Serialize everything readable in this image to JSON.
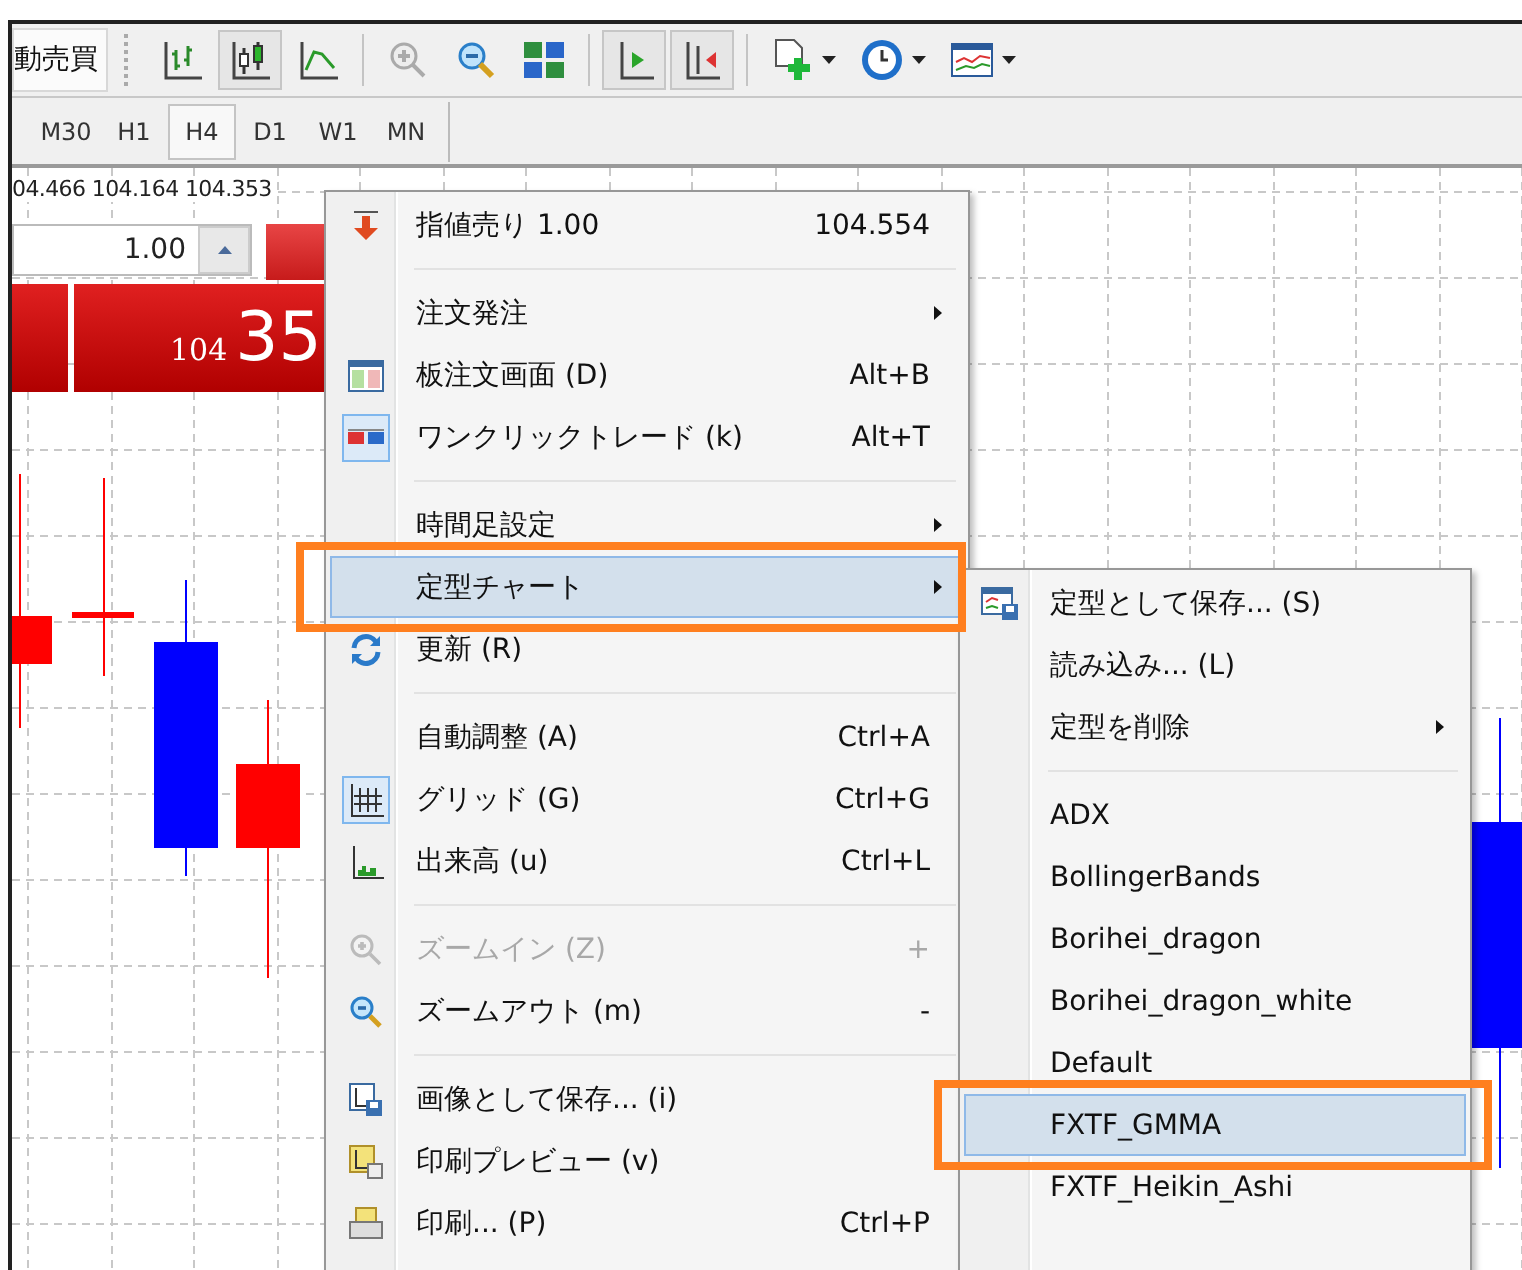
{
  "toolbar": {
    "partial_label": "動売買",
    "buttons": [
      {
        "kind": "bar-chart",
        "pressed": false,
        "dropdown": false
      },
      {
        "kind": "candle-chart",
        "pressed": true,
        "dropdown": false
      },
      {
        "kind": "line-chart",
        "pressed": false,
        "dropdown": false
      },
      {
        "kind": "zoom-in",
        "pressed": false,
        "dropdown": false
      },
      {
        "kind": "zoom-out",
        "pressed": false,
        "dropdown": false
      },
      {
        "kind": "tile",
        "pressed": false,
        "dropdown": false
      },
      {
        "kind": "auto-scroll",
        "pressed": true,
        "dropdown": false
      },
      {
        "kind": "chart-shift",
        "pressed": true,
        "dropdown": false
      },
      {
        "kind": "new-chart",
        "pressed": false,
        "dropdown": true
      },
      {
        "kind": "clock",
        "pressed": false,
        "dropdown": true
      },
      {
        "kind": "indicator",
        "pressed": false,
        "dropdown": true
      }
    ]
  },
  "timeframes": [
    {
      "label": "M30",
      "selected": false
    },
    {
      "label": "H1",
      "selected": false
    },
    {
      "label": "H4",
      "selected": true
    },
    {
      "label": "D1",
      "selected": false
    },
    {
      "label": "W1",
      "selected": false
    },
    {
      "label": "MN",
      "selected": false
    }
  ],
  "quote": {
    "prices": "04.466 104.164 104.353",
    "lots": "1.00",
    "price_small": "104",
    "price_big": "35"
  },
  "menu": {
    "items": [
      {
        "kind": "item",
        "label": "指値売り 1.00",
        "shortcut": "104.554",
        "checked": false,
        "disabled": false,
        "selected": false
      },
      {
        "kind": "separator"
      },
      {
        "kind": "item",
        "label": "注文発注",
        "submenu": true,
        "checked": false,
        "disabled": false,
        "selected": false
      },
      {
        "kind": "item",
        "label": "板注文画面 (D)",
        "shortcut": "Alt+B",
        "checked": false,
        "disabled": false,
        "selected": false
      },
      {
        "kind": "item",
        "label": "ワンクリックトレード (k)",
        "shortcut": "Alt+T",
        "checked": true,
        "disabled": false,
        "selected": false
      },
      {
        "kind": "separator"
      },
      {
        "kind": "item",
        "label": "時間足設定",
        "submenu": true,
        "checked": false,
        "disabled": false,
        "selected": false
      },
      {
        "kind": "item",
        "label": "定型チャート",
        "submenu": true,
        "checked": false,
        "disabled": false,
        "selected": true,
        "annotated": true
      },
      {
        "kind": "item",
        "label": "更新 (R)",
        "checked": false,
        "disabled": false,
        "selected": false
      },
      {
        "kind": "separator"
      },
      {
        "kind": "item",
        "label": "自動調整 (A)",
        "shortcut": "Ctrl+A",
        "checked": false,
        "disabled": false,
        "selected": false
      },
      {
        "kind": "item",
        "label": "グリッド (G)",
        "shortcut": "Ctrl+G",
        "checked": true,
        "disabled": false,
        "selected": false
      },
      {
        "kind": "item",
        "label": "出来高 (u)",
        "shortcut": "Ctrl+L",
        "checked": false,
        "disabled": false,
        "selected": false
      },
      {
        "kind": "separator"
      },
      {
        "kind": "item",
        "label": "ズームイン (Z)",
        "shortcut": "+",
        "checked": false,
        "disabled": true,
        "selected": false
      },
      {
        "kind": "item",
        "label": "ズームアウト (m)",
        "shortcut": "-",
        "checked": false,
        "disabled": false,
        "selected": false
      },
      {
        "kind": "separator"
      },
      {
        "kind": "item",
        "label": "画像として保存... (i)",
        "checked": false,
        "disabled": false,
        "selected": false
      },
      {
        "kind": "item",
        "label": "印刷プレビュー (v)",
        "checked": false,
        "disabled": false,
        "selected": false
      },
      {
        "kind": "item",
        "label": "印刷... (P)",
        "shortcut": "Ctrl+P",
        "checked": false,
        "disabled": false,
        "selected": false
      }
    ]
  },
  "submenu": {
    "items": [
      {
        "kind": "item",
        "label": "定型として保存... (S)",
        "selected": false
      },
      {
        "kind": "item",
        "label": "読み込み... (L)",
        "selected": false
      },
      {
        "kind": "item",
        "label": "定型を削除",
        "submenu": true,
        "selected": false
      },
      {
        "kind": "separator"
      },
      {
        "kind": "item",
        "label": "ADX",
        "selected": false
      },
      {
        "kind": "item",
        "label": "BollingerBands",
        "selected": false
      },
      {
        "kind": "item",
        "label": "Borihei_dragon",
        "selected": false
      },
      {
        "kind": "item",
        "label": "Borihei_dragon_white",
        "selected": false
      },
      {
        "kind": "item",
        "label": "Default",
        "selected": false
      },
      {
        "kind": "item",
        "label": "FXTF_GMMA",
        "selected": true,
        "annotated": true
      },
      {
        "kind": "item",
        "label": "FXTF_Heikin_Ashi",
        "selected": false
      }
    ]
  }
}
